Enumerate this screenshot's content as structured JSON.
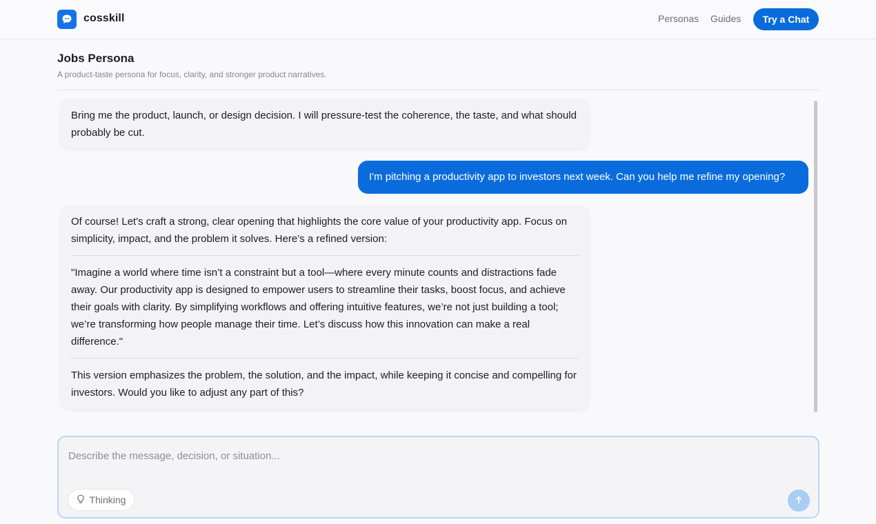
{
  "header": {
    "brand": "cosskill",
    "nav": [
      "Personas",
      "Guides"
    ],
    "cta_label": "Try a Chat"
  },
  "persona": {
    "title": "Jobs Persona",
    "subtitle": "A product-taste persona for focus, clarity, and stronger product narratives."
  },
  "messages": [
    {
      "role": "assistant",
      "paragraphs": [
        "Bring me the product, launch, or design decision. I will pressure-test the coherence, the taste, and what should probably be cut."
      ]
    },
    {
      "role": "user",
      "text": "I'm pitching a productivity app to investors next week. Can you help me refine my opening?"
    },
    {
      "role": "assistant",
      "paragraphs": [
        "Of course! Let's craft a strong, clear opening that highlights the core value of your productivity app. Focus on simplicity, impact, and the problem it solves. Here’s a refined version:",
        "\"Imagine a world where time isn’t a constraint but a tool—where every minute counts and distractions fade away. Our productivity app is designed to empower users to streamline their tasks, boost focus, and achieve their goals with clarity. By simplifying workflows and offering intuitive features, we’re not just building a tool; we’re transforming how people manage their time. Let’s discuss how this innovation can make a real difference.\"",
        "This version emphasizes the problem, the solution, and the impact, while keeping it concise and compelling for investors. Would you like to adjust any part of this?"
      ]
    }
  ],
  "composer": {
    "placeholder": "Describe the message, decision, or situation...",
    "value": "",
    "thinking_label": "Thinking"
  },
  "colors": {
    "accent": "#0a6cdc",
    "send_disabled": "#a9cdf3",
    "composer_focus_border": "#b9d6f5"
  },
  "icons": {
    "logo": "chat-bubble-icon",
    "thinking": "lightbulb-icon",
    "send": "arrow-up-icon"
  }
}
